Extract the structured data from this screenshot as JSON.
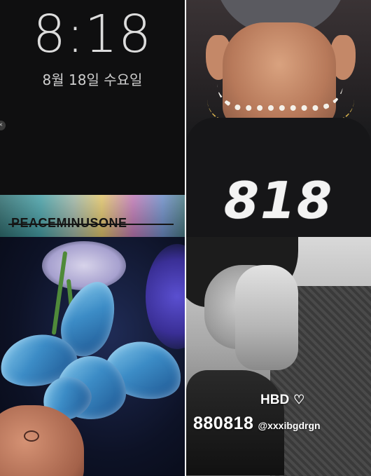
{
  "lockscreen": {
    "time": "8:18",
    "date": "8월 18일 수요일"
  },
  "shirt": {
    "number": "818"
  },
  "banner": {
    "text": "PEACEMINUSONE"
  },
  "story": {
    "greeting": "HBD",
    "heart_icon": "heart-icon",
    "birthday": "880818",
    "handle": "@xxxibgdrgn"
  },
  "colors": {
    "banner_gradient": [
      "#2f6d6f",
      "#47a0a7",
      "#e0c56c",
      "#c07ab6",
      "#6e8ec8"
    ],
    "flower_blue": "#3c8cc6",
    "text_white": "#ffffff"
  }
}
